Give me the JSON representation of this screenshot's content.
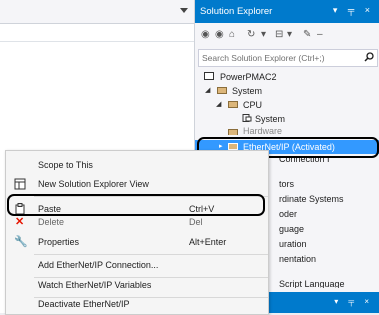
{
  "solution_explorer": {
    "title": "Solution Explorer",
    "title_tools": "▾ ╤ ×",
    "search_placeholder": "Search Solution Explorer (Ctrl+;)",
    "tree": [
      {
        "label": "PowerPMAC2",
        "icon": "project-icon"
      },
      {
        "label": "System",
        "icon": "folder-icon"
      },
      {
        "label": "CPU",
        "icon": "folder-icon"
      },
      {
        "label": "System",
        "icon": "component-icon"
      },
      {
        "label": "Hardware",
        "icon": "folder-icon"
      },
      {
        "label": "EtherNet/IP (Activated)",
        "icon": "folder-icon",
        "selected": true
      },
      {
        "label": "Connection I"
      },
      {
        "label": "tors"
      },
      {
        "label": "rdinate Systems"
      },
      {
        "label": "oder"
      },
      {
        "label": "guage"
      },
      {
        "label": "uration"
      },
      {
        "label": "nentation"
      },
      {
        "label": "Script Language"
      }
    ],
    "bottom_tools": "▾ ╤ ×"
  },
  "context_menu": {
    "items": [
      {
        "label": "Scope to This",
        "shortcut": "",
        "icon": ""
      },
      {
        "label": "New Solution Explorer View",
        "shortcut": "",
        "icon": "new-view-icon"
      },
      {
        "label": "Paste",
        "shortcut": "Ctrl+V",
        "icon": "paste-icon"
      },
      {
        "label": "Delete",
        "shortcut": "Del",
        "icon": "delete-icon"
      },
      {
        "label": "Properties",
        "shortcut": "Alt+Enter",
        "icon": "wrench-icon"
      },
      {
        "label": "Add EtherNet/IP Connection...",
        "shortcut": "",
        "icon": ""
      },
      {
        "label": "Watch EtherNet/IP Variables",
        "shortcut": "",
        "icon": ""
      },
      {
        "label": "Deactivate EtherNet/IP",
        "shortcut": "",
        "icon": ""
      }
    ]
  },
  "colors": {
    "accent": "#007acc",
    "selection": "#3399ff",
    "delete": "#e51400"
  }
}
